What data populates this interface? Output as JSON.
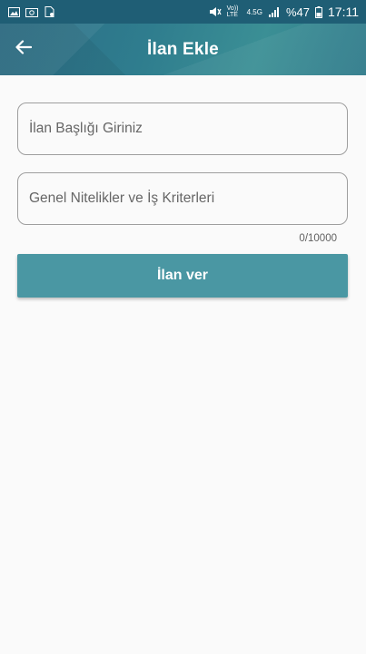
{
  "status_bar": {
    "battery": "%47",
    "time": "17:11",
    "network_1": "Vo)) LTE",
    "network_2": "4.5G"
  },
  "app_bar": {
    "title": "İlan Ekle"
  },
  "form": {
    "title_placeholder": "İlan Başlığı Giriniz",
    "criteria_placeholder": "Genel Nitelikler ve İş Kriterleri",
    "counter": "0/10000",
    "submit_label": "İlan ver"
  },
  "colors": {
    "app_bar": "#2f7d8e",
    "button": "#4a97a3",
    "background": "#fafafa"
  }
}
